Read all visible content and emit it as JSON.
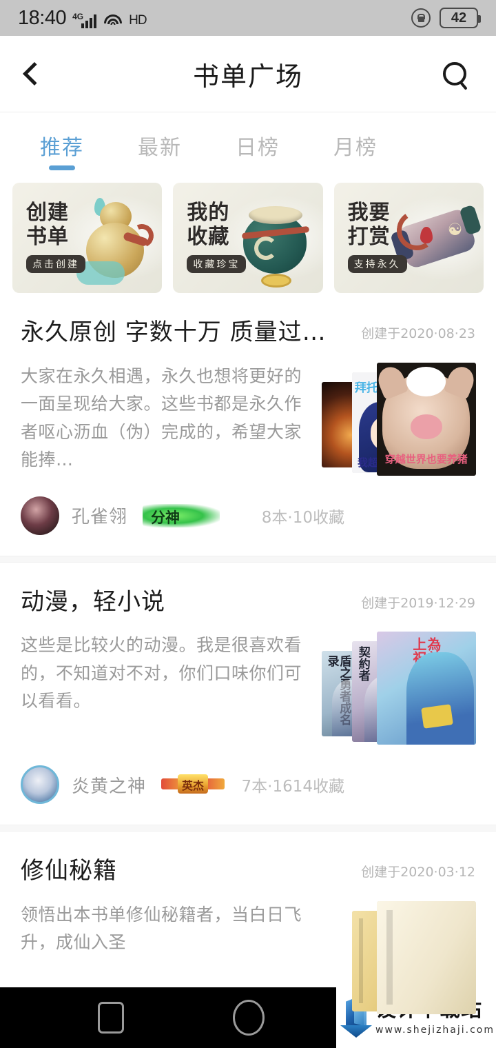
{
  "status_bar": {
    "time": "18:40",
    "network_label": "4G",
    "hd_label": "HD",
    "battery_level": "42",
    "icons": [
      "signal-bars-icon",
      "wifi-icon",
      "hd-icon",
      "rotation-lock-icon",
      "battery-icon"
    ]
  },
  "top_bar": {
    "back_icon": "back-chevron-icon",
    "title": "书单广场",
    "search_icon": "search-icon"
  },
  "tabs": [
    {
      "label": "推荐",
      "active": true
    },
    {
      "label": "最新",
      "active": false
    },
    {
      "label": "日榜",
      "active": false
    },
    {
      "label": "月榜",
      "active": false
    }
  ],
  "promo_cards": [
    {
      "line1": "创建",
      "line2": "书单",
      "subtitle": "点击创建",
      "art": "gourd"
    },
    {
      "line1": "我的",
      "line2": "收藏",
      "subtitle": "收藏珍宝",
      "art": "pot"
    },
    {
      "line1": "我要",
      "line2": "打赏",
      "subtitle": "支持永久",
      "art": "lantern"
    }
  ],
  "book_lists": [
    {
      "title": "永久原创 字数十万 质量过…",
      "date": "创建于2020·08·23",
      "description": "大家在永久相遇，永久也想将更好的一面呈现给大家。这些书都是永久作者呕心沥血（伪）完成的，希望大家能捧…",
      "author": "孔雀翎",
      "badge_text": "分神",
      "badge_style": "green",
      "stats": "8本·10收藏",
      "thumbnails": [
        {
          "kind": "fire",
          "caption": ""
        },
        {
          "kind": "anime",
          "caption_top": "拜托",
          "caption_bottom": "我超"
        },
        {
          "kind": "pig",
          "caption": "穿越世界也要养猪"
        }
      ]
    },
    {
      "title": "动漫，轻小说",
      "date": "创建于2019·12·29",
      "description": "这些是比较火的动漫。我是很喜欢看的，不知道对不对，你们口味你们可以看看。",
      "author": "炎黄之神",
      "badge_text": "英杰",
      "badge_style": "gold",
      "stats": "7本·1614收藏",
      "thumbnails": [
        {
          "kind": "novel-shield",
          "caption": "盾之勇者成名录"
        },
        {
          "kind": "novel-contract",
          "caption": "契約者"
        },
        {
          "kind": "novel-kono",
          "caption": "為美好的世界獻上祝福！"
        }
      ]
    },
    {
      "title": "修仙秘籍",
      "date": "创建于2020·03·12",
      "description": "领悟出本书单修仙秘籍者，当白日飞升，成仙入圣",
      "author": "",
      "badge_text": "",
      "badge_style": "",
      "stats": "",
      "thumbnails": [
        {
          "kind": "book-yellow",
          "caption": ""
        },
        {
          "kind": "book-cream",
          "caption": ""
        }
      ]
    }
  ],
  "nav_bar": {
    "recents_icon": "recents-square-icon",
    "home_icon": "home-circle-icon"
  },
  "watermark": {
    "site_name": "设计下载站",
    "url": "www.shejizhaji.com",
    "logo_icon": "shejizhaji-logo-icon"
  },
  "colors": {
    "accent_blue": "#5a9fd4",
    "status_bar_bg": "#c6c6c6",
    "title_text": "#1a1a1a",
    "muted_text": "#9a9a9a",
    "date_text": "#b5b5b5",
    "nav_bg": "#000000"
  }
}
